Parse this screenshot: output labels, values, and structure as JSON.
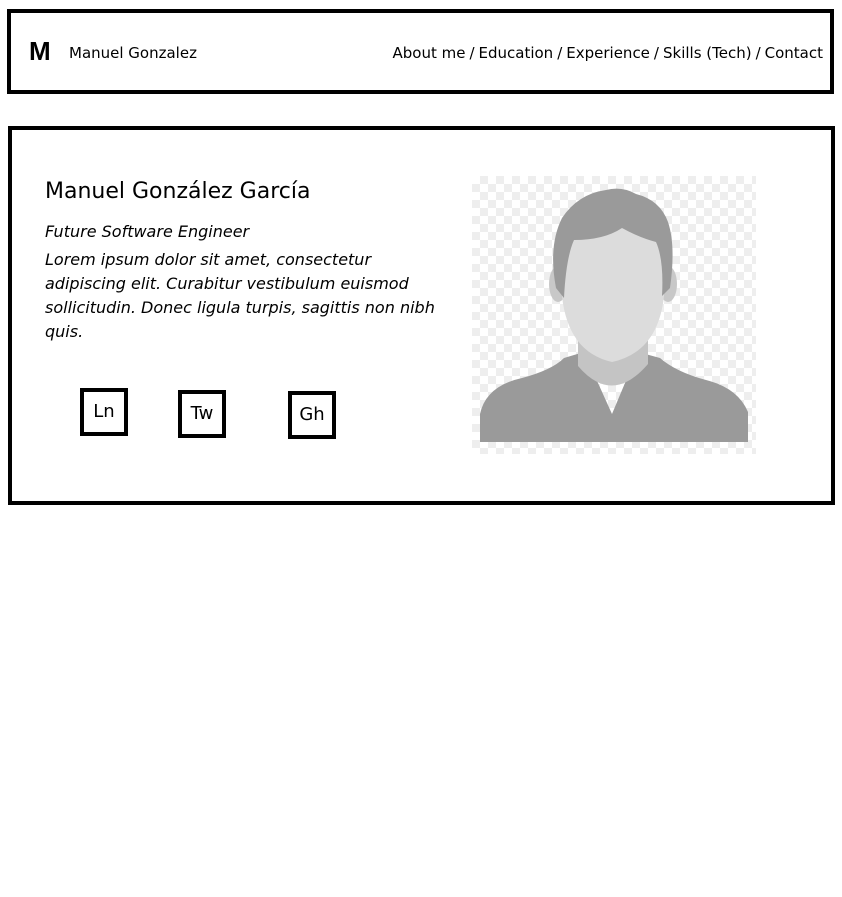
{
  "header": {
    "logo": "M",
    "site_name": "Manuel Gonzalez",
    "nav": {
      "about": "About me",
      "education": "Education",
      "experience": "Experience",
      "skills": "Skills (Tech)",
      "contact": "Contact",
      "separator": "/"
    }
  },
  "hero": {
    "name": "Manuel González García",
    "role": "Future Software Engineer",
    "bio": "Lorem ipsum dolor sit amet, consectetur adipiscing elit. Curabitur vestibulum euismod sollicitudin. Donec ligula turpis, sagittis non nibh quis.",
    "social": {
      "linkedin": "Ln",
      "twitter": "Tw",
      "github": "Gh"
    },
    "photo_icon": "avatar-placeholder-icon"
  }
}
